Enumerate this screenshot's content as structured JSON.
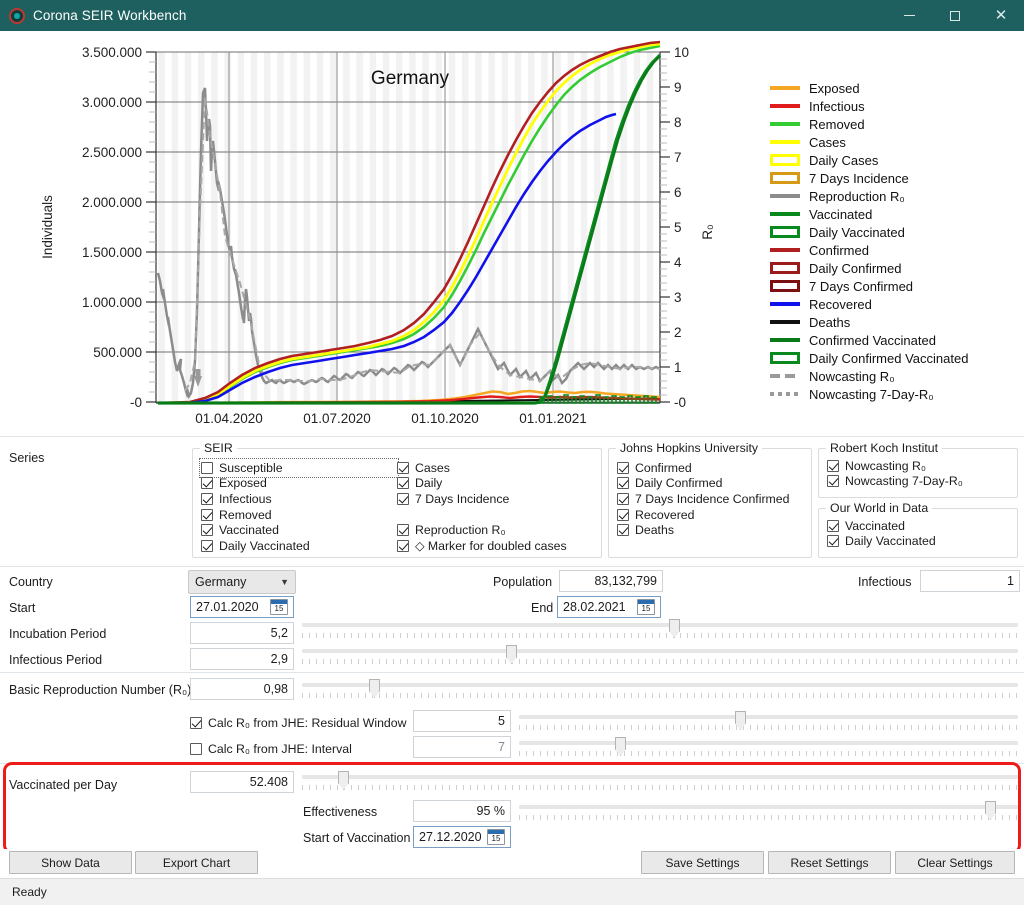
{
  "window": {
    "title": "Corona SEIR Workbench",
    "app_icon": "corona-virus-icon",
    "minimize_label": "—",
    "maximize_label": "□",
    "close_label": "✕",
    "titlebar_color": "#1e5f5f"
  },
  "chart_data": {
    "type": "line",
    "title": "Germany",
    "xlabel": "",
    "ylabel": "Individuals",
    "y2label": "R₀",
    "grid": true,
    "legend_position": "right",
    "xlim": [
      "27.01.2020",
      "28.02.2021"
    ],
    "ylim": [
      0,
      3500000
    ],
    "y2lim": [
      0,
      10
    ],
    "xticks": [
      "01.04.2020",
      "01.07.2020",
      "01.10.2020",
      "01.01.2021"
    ],
    "yticks": [
      "-0",
      "500.000",
      "1.000.000",
      "1.500.000",
      "2.000.000",
      "2.500.000",
      "3.000.000",
      "3.500.000"
    ],
    "y2ticks": [
      "-0",
      "1",
      "2",
      "3",
      "4",
      "5",
      "6",
      "7",
      "8",
      "9",
      "10"
    ],
    "series": [
      {
        "name": "Exposed",
        "color": "#f5a623",
        "style": "line",
        "axis": "left"
      },
      {
        "name": "Infectious",
        "color": "#e01b1b",
        "style": "line",
        "axis": "left"
      },
      {
        "name": "Removed",
        "color": "#33cc33",
        "style": "line",
        "axis": "left"
      },
      {
        "name": "Cases",
        "color": "#ffff00",
        "style": "line",
        "axis": "left"
      },
      {
        "name": "Daily Cases",
        "color": "#ffff00",
        "style": "box",
        "axis": "left"
      },
      {
        "name": "7 Days Incidence",
        "color": "#d79a15",
        "style": "box",
        "axis": "left"
      },
      {
        "name": "Reproduction R₀",
        "color": "#8c8c8c",
        "style": "line",
        "axis": "right"
      },
      {
        "name": "Vaccinated",
        "color": "#0a8a1e",
        "style": "line",
        "axis": "left"
      },
      {
        "name": "Daily Vaccinated",
        "color": "#0a8a1e",
        "style": "box",
        "axis": "left"
      },
      {
        "name": "Confirmed",
        "color": "#b02020",
        "style": "line",
        "axis": "left"
      },
      {
        "name": "Daily Confirmed",
        "color": "#9b1c1c",
        "style": "box",
        "axis": "left"
      },
      {
        "name": "7 Days Confirmed",
        "color": "#7a1010",
        "style": "box",
        "axis": "left"
      },
      {
        "name": "Recovered",
        "color": "#1111ee",
        "style": "line",
        "axis": "left"
      },
      {
        "name": "Deaths",
        "color": "#111111",
        "style": "line",
        "axis": "left"
      },
      {
        "name": "Confirmed Vaccinated",
        "color": "#0a7a18",
        "style": "line",
        "axis": "left"
      },
      {
        "name": "Daily Confirmed Vaccinated",
        "color": "#0a8a1e",
        "style": "box",
        "axis": "left"
      },
      {
        "name": "Nowcasting R₀",
        "color": "#9a9a9a",
        "style": "dash",
        "axis": "right"
      },
      {
        "name": "Nowcasting 7-Day-R₀",
        "color": "#9a9a9a",
        "style": "dot",
        "axis": "right"
      }
    ]
  },
  "series_panel": {
    "label": "Series",
    "groups": [
      {
        "title": "SEIR",
        "items": [
          {
            "label": "Susceptible",
            "checked": false,
            "focused": true,
            "accel": "S"
          },
          {
            "label": "Exposed",
            "checked": true,
            "accel": "E"
          },
          {
            "label": "Infectious",
            "checked": true,
            "accel": "I"
          },
          {
            "label": "Removed",
            "checked": true,
            "accel": "R"
          },
          {
            "label": "Vaccinated",
            "checked": true,
            "accel": "V"
          },
          {
            "label": "Daily Vaccinated",
            "checked": true
          }
        ],
        "items2": [
          {
            "label": "Cases",
            "checked": true
          },
          {
            "label": "Daily",
            "checked": true
          },
          {
            "label": "7 Days Incidence",
            "checked": true
          },
          {
            "label": "",
            "checked": null
          },
          {
            "label": "Reproduction R₀",
            "checked": true
          },
          {
            "label": "◇ Marker for doubled cases",
            "checked": true
          }
        ]
      },
      {
        "title": "Johns Hopkins University",
        "items": [
          {
            "label": "Confirmed",
            "checked": true
          },
          {
            "label": "Daily Confirmed",
            "checked": true
          },
          {
            "label": "7 Days Incidence Confirmed",
            "checked": true
          },
          {
            "label": "Recovered",
            "checked": true
          },
          {
            "label": "Deaths",
            "checked": true
          }
        ]
      },
      {
        "title": "Robert Koch Institut",
        "items": [
          {
            "label": "Nowcasting R₀",
            "checked": true
          },
          {
            "label": "Nowcasting 7-Day-R₀",
            "checked": true
          }
        ]
      },
      {
        "title": "Our World in Data",
        "items": [
          {
            "label": "Vaccinated",
            "checked": true
          },
          {
            "label": "Daily Vaccinated",
            "checked": true
          }
        ]
      }
    ]
  },
  "params": {
    "country_label": "Country",
    "country_value": "Germany",
    "start_label": "Start",
    "start_value": "27.01.2020",
    "incubation_label": "Incubation Period",
    "incubation_value": "5,2",
    "infectious_period_label": "Infectious Period",
    "infectious_period_value": "2,9",
    "population_label": "Population",
    "population_value": "83,132,799",
    "end_label": "End",
    "end_value": "28.02.2021",
    "infectious_label": "Infectious",
    "infectious_value": "1",
    "r0_label": "Basic Reproduction Number (R₀)",
    "r0_value": "0,98",
    "calc_residual_label": "Calc R₀ from JHE: Residual Window",
    "calc_residual_checked": true,
    "residual_value": "5",
    "calc_interval_label": "Calc R₀ from JHE: Interval",
    "calc_interval_checked": false,
    "interval_value": "7",
    "vaccinated_per_day_label": "Vaccinated per Day",
    "vaccinated_per_day_value": "52.408",
    "effectiveness_label": "Effectiveness",
    "effectiveness_value": "95 %",
    "start_vaccination_label": "Start of Vaccination",
    "start_vaccination_value": "27.12.2020",
    "calendar_icon_day": "15",
    "annotation_color": "#ee1b1b"
  },
  "buttons": {
    "show_data": "Show Data",
    "export_chart": "Export Chart",
    "save_settings": "Save Settings",
    "reset_settings": "Reset Settings",
    "clear_settings": "Clear Settings"
  },
  "status": {
    "text": "Ready"
  }
}
